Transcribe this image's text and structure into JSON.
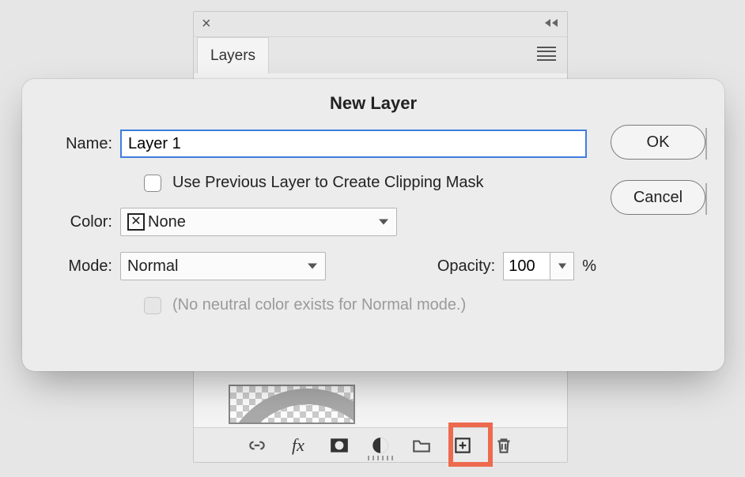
{
  "panel": {
    "tab_label": "Layers",
    "footer_icons": [
      "link-icon",
      "fx-icon",
      "mask-icon",
      "adjustment-icon",
      "group-icon",
      "new-layer-icon",
      "trash-icon"
    ]
  },
  "dialog": {
    "title": "New Layer",
    "name_label": "Name:",
    "name_value": "Layer 1",
    "clipping_label": "Use Previous Layer to Create Clipping Mask",
    "clipping_checked": false,
    "color_label": "Color:",
    "color_value": "None",
    "mode_label": "Mode:",
    "mode_value": "Normal",
    "opacity_label": "Opacity:",
    "opacity_value": "100",
    "opacity_unit": "%",
    "neutral_note": "(No neutral color exists for Normal mode.)",
    "ok_label": "OK",
    "cancel_label": "Cancel"
  }
}
